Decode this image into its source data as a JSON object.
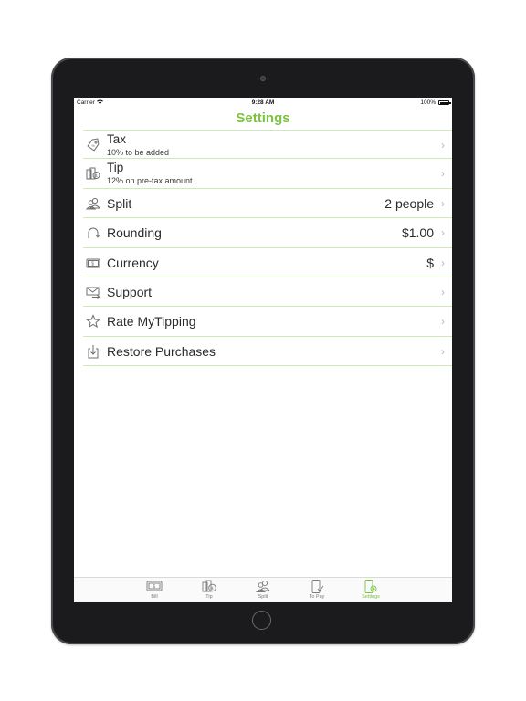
{
  "status_bar": {
    "carrier": "Carrier",
    "time": "9:28 AM",
    "battery": "100%"
  },
  "header": {
    "title": "Settings"
  },
  "settings": [
    {
      "icon": "tag-icon",
      "label": "Tax",
      "subtitle": "10% to be added",
      "value": ""
    },
    {
      "icon": "coins-icon",
      "label": "Tip",
      "subtitle": "12% on pre-tax amount",
      "value": ""
    },
    {
      "icon": "people-icon",
      "label": "Split",
      "subtitle": "",
      "value": "2 people"
    },
    {
      "icon": "rounding-icon",
      "label": "Rounding",
      "subtitle": "",
      "value": "$1.00"
    },
    {
      "icon": "banknote-icon",
      "label": "Currency",
      "subtitle": "",
      "value": "$"
    },
    {
      "icon": "mail-icon",
      "label": "Support",
      "subtitle": "",
      "value": ""
    },
    {
      "icon": "star-icon",
      "label": "Rate MyTipping",
      "subtitle": "",
      "value": ""
    },
    {
      "icon": "download-icon",
      "label": "Restore Purchases",
      "subtitle": "",
      "value": ""
    }
  ],
  "tab_bar": {
    "tabs": [
      {
        "label": "Bill",
        "icon": "bill-icon"
      },
      {
        "label": "Tip",
        "icon": "tip-icon"
      },
      {
        "label": "Split",
        "icon": "split-icon"
      },
      {
        "label": "To Pay",
        "icon": "to-pay-icon"
      },
      {
        "label": "Settings",
        "icon": "settings-icon"
      }
    ],
    "active": "Settings"
  },
  "colors": {
    "accent": "#7cc242",
    "separator": "#cfe8b6",
    "device_frame": "#1b1b1d"
  }
}
